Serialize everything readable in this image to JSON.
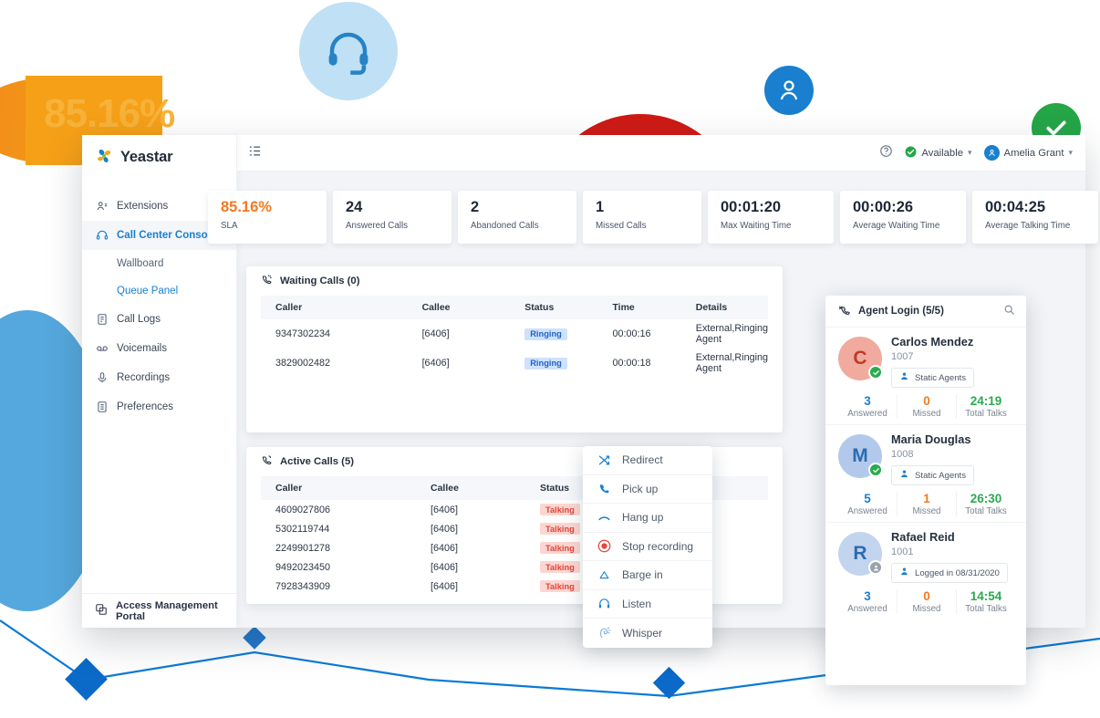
{
  "decor": {
    "orange_text": "85.16%",
    "headset_icon": "headset-icon",
    "user_icon": "user-icon",
    "check_icon": "check-icon"
  },
  "brand": {
    "name": "Yeastar"
  },
  "sidebar": {
    "items": [
      {
        "label": "Extensions",
        "icon": "extensions-icon",
        "active": false
      },
      {
        "label": "Call Center Console",
        "icon": "headset-icon",
        "active": true
      },
      {
        "label": "Call Logs",
        "icon": "call-logs-icon",
        "active": false
      },
      {
        "label": "Voicemails",
        "icon": "voicemail-icon",
        "active": false
      },
      {
        "label": "Recordings",
        "icon": "microphone-icon",
        "active": false
      },
      {
        "label": "Preferences",
        "icon": "preferences-icon",
        "active": false
      }
    ],
    "sub_items": [
      {
        "label": "Wallboard",
        "selected": false
      },
      {
        "label": "Queue Panel",
        "selected": true
      }
    ],
    "footer": {
      "label": "Access Management Portal",
      "icon": "portal-icon"
    }
  },
  "topbar": {
    "menu_icon": "hamburger-menu-icon",
    "help_icon": "help-icon",
    "status": "Available",
    "user": "Amelia Grant"
  },
  "kpis": [
    {
      "value": "85.16%",
      "label": "SLA",
      "accent": "#f4791f"
    },
    {
      "value": "24",
      "label": "Answered Calls"
    },
    {
      "value": "2",
      "label": "Abandoned Calls"
    },
    {
      "value": "1",
      "label": "Missed Calls"
    },
    {
      "value": "00:01:20",
      "label": "Max Waiting Time"
    },
    {
      "value": "00:00:26",
      "label": "Average Waiting Time"
    },
    {
      "value": "00:04:25",
      "label": "Average Talking Time"
    }
  ],
  "waiting_calls": {
    "title": "Waiting Calls (0)",
    "icon": "incoming-call-icon",
    "columns": [
      "Caller",
      "Callee",
      "Status",
      "Time",
      "Details"
    ],
    "rows": [
      {
        "caller": "9347302234",
        "callee": "[6406]",
        "status": "Ringing",
        "time": "00:00:16",
        "details": "External,Ringing Agent"
      },
      {
        "caller": "3829002482",
        "callee": "[6406]",
        "status": "Ringing",
        "time": "00:00:18",
        "details": "External,Ringing Agent"
      }
    ]
  },
  "active_calls": {
    "title": "Active Calls (5)",
    "icon": "active-call-icon",
    "columns": [
      "Caller",
      "Callee",
      "Status"
    ],
    "rows": [
      {
        "caller": "4609027806",
        "callee": "[6406]",
        "status": "Talking"
      },
      {
        "caller": "5302119744",
        "callee": "[6406]",
        "status": "Talking"
      },
      {
        "caller": "2249901278",
        "callee": "[6406]",
        "status": "Talking"
      },
      {
        "caller": "9492023450",
        "callee": "[6406]",
        "status": "Talking"
      },
      {
        "caller": "7928343909",
        "callee": "[6406]",
        "status": "Talking"
      }
    ]
  },
  "context_menu": {
    "items": [
      {
        "label": "Redirect",
        "icon": "redirect-icon"
      },
      {
        "label": "Pick up",
        "icon": "phone-icon"
      },
      {
        "label": "Hang up",
        "icon": "hangup-icon"
      },
      {
        "label": "Stop recording",
        "icon": "record-icon"
      },
      {
        "label": "Barge in",
        "icon": "barge-in-icon"
      },
      {
        "label": "Listen",
        "icon": "headphones-icon"
      },
      {
        "label": "Whisper",
        "icon": "whisper-icon"
      }
    ]
  },
  "agent_login": {
    "title": "Agent Login (5/5)",
    "icon": "agent-phone-icon",
    "search_icon": "search-icon",
    "stat_labels": {
      "answered": "Answered",
      "missed": "Missed",
      "total": "Total Talks"
    },
    "agents": [
      {
        "name": "Carlos Mendez",
        "ext": "1007",
        "initial": "C",
        "avatar_bg": "#f0aa9e",
        "avatar_fg": "#c0392b",
        "online": true,
        "tag": "Static Agents",
        "answered": "3",
        "missed": "0",
        "total_talks": "24:19"
      },
      {
        "name": "Maria Douglas",
        "ext": "1008",
        "initial": "M",
        "avatar_bg": "#b3c9ec",
        "avatar_fg": "#2b6cb0",
        "online": true,
        "tag": "Static Agents",
        "answered": "5",
        "missed": "1",
        "total_talks": "26:30"
      },
      {
        "name": "Rafael Reid",
        "ext": "1001",
        "initial": "R",
        "avatar_bg": "#c3d4ef",
        "avatar_fg": "#2b6cb0",
        "online": false,
        "tag": "Logged in 08/31/2020",
        "answered": "3",
        "missed": "0",
        "total_talks": "14:54"
      }
    ]
  }
}
